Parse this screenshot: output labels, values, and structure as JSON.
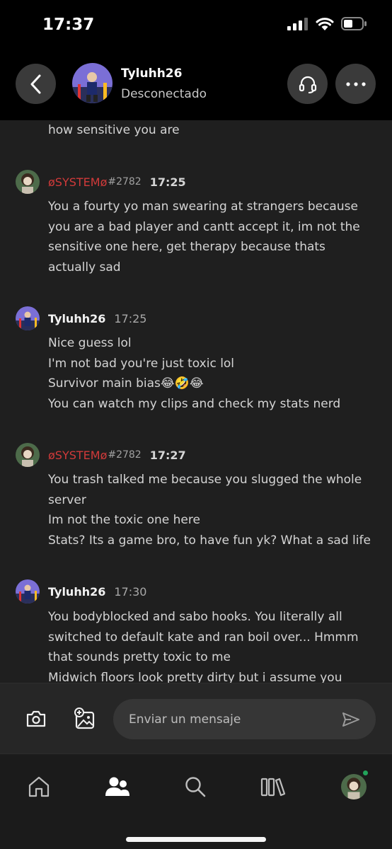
{
  "status_bar": {
    "time": "17:37"
  },
  "header": {
    "name": "Tyluhh26",
    "status": "Desconectado"
  },
  "messages": [
    {
      "type": "continuation",
      "lines": [
        "how sensitive you are"
      ]
    },
    {
      "type": "group",
      "author": "øSYSTEMø",
      "tag": "#2782",
      "time": "17:25",
      "lines": [
        "You a fourty yo man swearing at strangers because",
        "you are a bad player and cantt accept it, im not the",
        "sensitive one here, get therapy because thats",
        "actually sad"
      ]
    },
    {
      "type": "group",
      "author": "Tyluhh26",
      "time": "17:25",
      "lines": [
        "Nice guess lol",
        "I'm not bad you're just toxic lol",
        "Survivor main bias😂🤣😂",
        "You can watch my clips and check my stats nerd"
      ]
    },
    {
      "type": "group",
      "author": "øSYSTEMø",
      "tag": "#2782",
      "time": "17:27",
      "lines": [
        "You trash talked me because you slugged the whole",
        "server",
        "Im not the toxic one here",
        "Stats? Its a game bro, to have fun yk? What a sad life"
      ]
    },
    {
      "type": "group",
      "author": "Tyluhh26",
      "time": "17:30",
      "lines": [
        "You bodyblocked and sabo hooks. You literally all",
        "switched to default kate and ran boil over...  Hmmm",
        "that sounds pretty toxic to me",
        "Midwich floors look pretty dirty but i assume you"
      ]
    }
  ],
  "composer": {
    "placeholder": "Enviar un mensaje"
  },
  "icons": {
    "back": "chevron-left-icon",
    "headset": "headset-icon",
    "more": "more-horizontal-icon",
    "camera": "camera-icon",
    "image_add": "image-add-icon",
    "send": "send-icon",
    "home": "home-icon",
    "friends": "friends-icon",
    "search": "search-icon",
    "library": "library-icon"
  },
  "colors": {
    "system_author": "#d13a3a",
    "online": "#22a45a",
    "background": "#1f1f1f"
  }
}
